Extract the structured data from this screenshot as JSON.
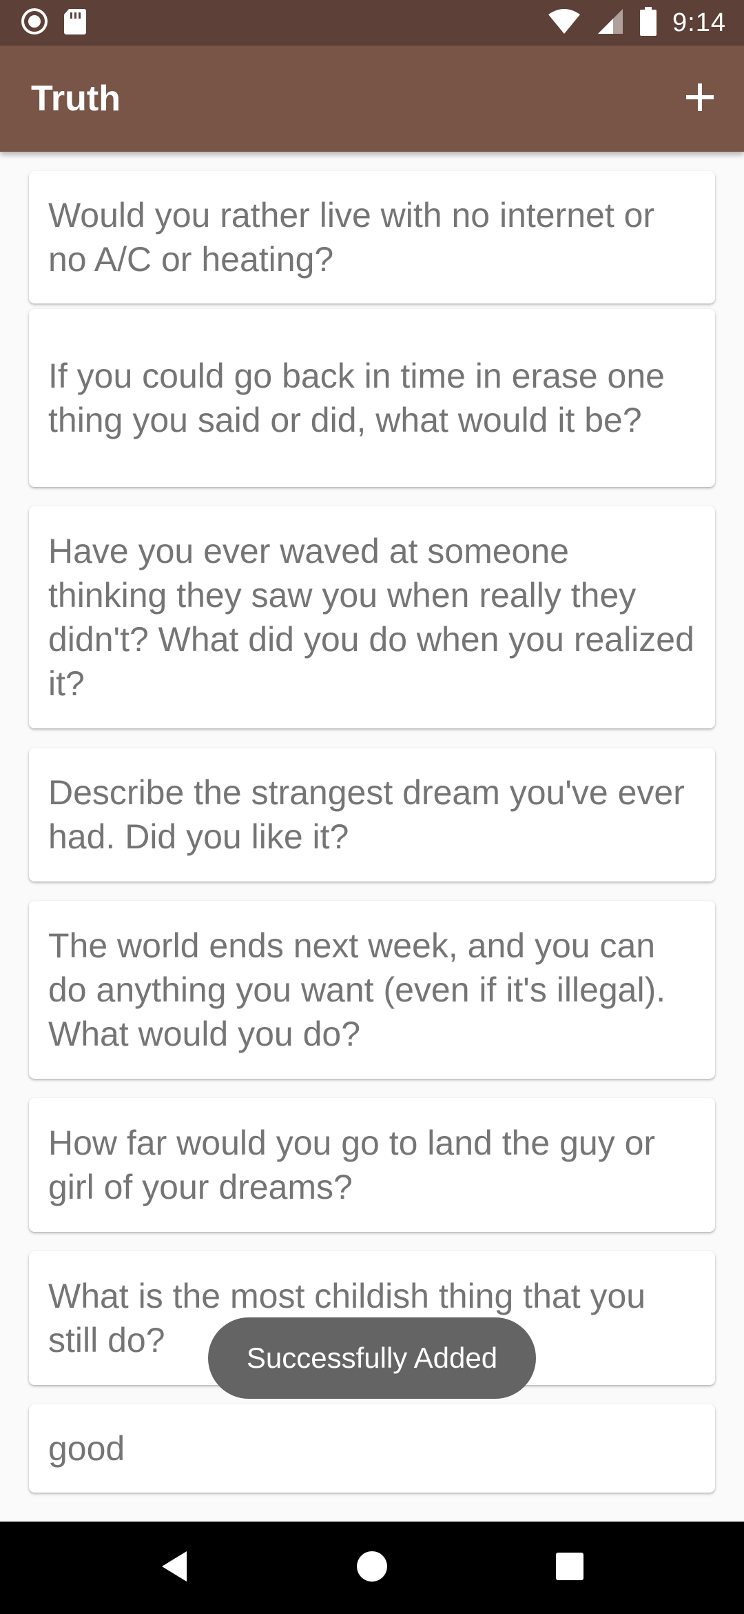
{
  "status_bar": {
    "time": "9:14",
    "left_icons": [
      "record-icon",
      "sd-card-icon"
    ],
    "right_icons": [
      "wifi-icon",
      "signal-icon",
      "battery-icon"
    ]
  },
  "app_bar": {
    "title": "Truth",
    "action_icon": "plus-icon"
  },
  "cards": [
    {
      "text": "Would you rather live with no internet or no A/C or heating?"
    },
    {
      "text": "If you could go back in time in erase one thing you said or did, what would it be?"
    },
    {
      "text": "Have you ever waved at someone thinking they saw you when really they didn't? What did you do when you realized it?"
    },
    {
      "text": "Describe the strangest dream you've ever had. Did you like it?"
    },
    {
      "text": "The world ends next week, and you can do anything you want (even if it's illegal). What would you do?"
    },
    {
      "text": "How far would you go to land the guy or girl of your dreams?"
    },
    {
      "text": "What is the most childish thing that you still do?"
    },
    {
      "text": "good"
    }
  ],
  "toast": {
    "message": "Successfully Added"
  },
  "nav_bar": {
    "buttons": [
      "back-icon",
      "home-icon",
      "recents-icon"
    ]
  },
  "colors": {
    "status_bar": "#5d4037",
    "app_bar": "#795548",
    "card_text": "#757575",
    "background": "#fafafa",
    "toast": "#646464"
  }
}
